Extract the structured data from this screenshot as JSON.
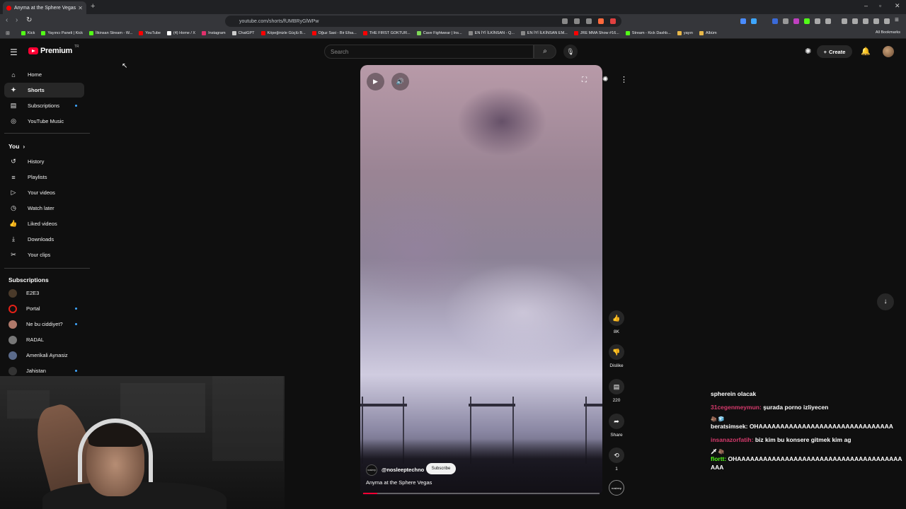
{
  "browser": {
    "tab_title": "Anyma at the Sphere Vegas",
    "url": "youtube.com/shorts/fUMBRyGlWPw",
    "bookmarks": [
      {
        "label": "Kick",
        "color": "#53fc18"
      },
      {
        "label": "Yayıncı Paneli | Kick",
        "color": "#53fc18"
      },
      {
        "label": "İlkinsan Stream - W...",
        "color": "#53fc18"
      },
      {
        "label": "YouTube",
        "color": "#ff0000"
      },
      {
        "label": "(4) Home / X",
        "color": "#ffffff"
      },
      {
        "label": "Instagram",
        "color": "#e1306c"
      },
      {
        "label": "ChatGPT",
        "color": "#cccccc"
      },
      {
        "label": "Köpeğinizle Güçlü B...",
        "color": "#ff0000"
      },
      {
        "label": "Oğuz Sasi - Bir Efsa...",
        "color": "#ff0000"
      },
      {
        "label": "THE FIRST GOKTUR...",
        "color": "#ff0000"
      },
      {
        "label": "Cave Fightwear | Ins...",
        "color": "#7ed957"
      },
      {
        "label": "EN İYİ İLKİNSAN - Q...",
        "color": "#888888"
      },
      {
        "label": "EN İYİ İLKİNSAN EM...",
        "color": "#888888"
      },
      {
        "label": "JRE MMA Show #16...",
        "color": "#ff0000"
      },
      {
        "label": "Stream - Kick Dashb...",
        "color": "#53fc18"
      },
      {
        "label": "yayın",
        "color": "#e8b84a"
      },
      {
        "label": "Albüm",
        "color": "#e8b84a"
      }
    ],
    "all_bookmarks": "All Bookmarks"
  },
  "header": {
    "logo_text": "Premium",
    "region": "TR",
    "search_placeholder": "Search",
    "create_label": "Create"
  },
  "sidebar": {
    "main": [
      {
        "label": "Home",
        "icon": "home-icon",
        "glyph": "⌂"
      },
      {
        "label": "Shorts",
        "icon": "shorts-icon",
        "glyph": "✦"
      },
      {
        "label": "Subscriptions",
        "icon": "subscriptions-icon",
        "glyph": "▤"
      },
      {
        "label": "YouTube Music",
        "icon": "music-icon",
        "glyph": "◎"
      }
    ],
    "you_label": "You",
    "you": [
      {
        "label": "History",
        "icon": "history-icon",
        "glyph": "↺"
      },
      {
        "label": "Playlists",
        "icon": "playlists-icon",
        "glyph": "≡"
      },
      {
        "label": "Your videos",
        "icon": "your-videos-icon",
        "glyph": "▷"
      },
      {
        "label": "Watch later",
        "icon": "clock-icon",
        "glyph": "◷"
      },
      {
        "label": "Liked videos",
        "icon": "thumbs-up-icon",
        "glyph": "👍"
      },
      {
        "label": "Downloads",
        "icon": "download-icon",
        "glyph": "⤓"
      },
      {
        "label": "Your clips",
        "icon": "scissors-icon",
        "glyph": "✂"
      }
    ],
    "subs_label": "Subscriptions",
    "subs": [
      {
        "label": "E2E3",
        "color": "#4a3a2a"
      },
      {
        "label": "Portal",
        "color": "#e62117"
      },
      {
        "label": "Ne bu ciddiyet?",
        "color": "#b0796a"
      },
      {
        "label": "RADAL",
        "color": "#777777"
      },
      {
        "label": "Amerikali Aynasiz",
        "color": "#5a6a8a"
      },
      {
        "label": "Jahistan",
        "color": "#333333"
      }
    ]
  },
  "short": {
    "channel": "@nosleeptechno",
    "channel_avatar_text": "nosleep",
    "subscribe_label": "Subscribe",
    "title": "Anyma at the Sphere Vegas",
    "progress_fraction": 0.06,
    "likes": "8K",
    "dislike_label": "Dislike",
    "comments": "220",
    "share_label": "Share",
    "remix_count": "1"
  },
  "chat": [
    {
      "user": "",
      "text": "spherein olacak",
      "user_color": "#ffffff",
      "badges": ""
    },
    {
      "user": "31cegenmeymun:",
      "text": "şurada porno izliyecen",
      "user_color": "#d63a6c",
      "badges": ""
    },
    {
      "user": "beratsimsek:",
      "text": "OHAAAAAAAAAAAAAAAAAAAAAAAAAAAAAAA",
      "user_color": "#ffffff",
      "badges": "🦣 🧊"
    },
    {
      "user": "insanazorfatih:",
      "text": "biz kim bu konsere gitmek kim ag",
      "user_color": "#d63a6c",
      "badges": ""
    },
    {
      "user": "flortt:",
      "text": "OHAAAAAAAAAAAAAAAAAAAAAAAAAAAAAAAAAAAAAAAAA",
      "user_color": "#53fc18",
      "badges": "🗡 🦣"
    }
  ]
}
